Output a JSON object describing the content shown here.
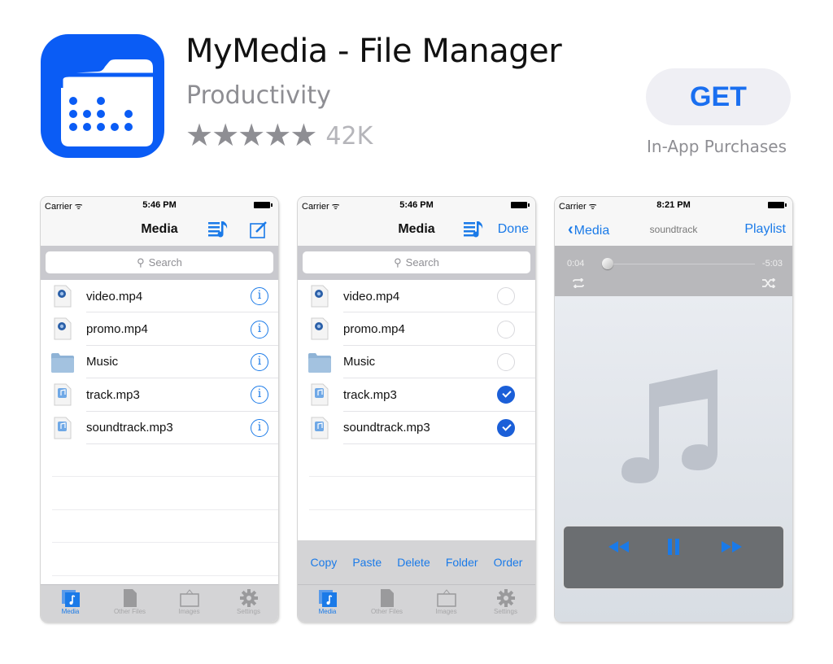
{
  "app": {
    "name": "MyMedia - File Manager",
    "category": "Productivity",
    "rating_stars": 4.5,
    "rating_max": 5,
    "rating_count": "42K",
    "get_label": "GET",
    "in_app_purchases": "In-App Purchases",
    "icon": "folder-dots-icon",
    "brand_color": "#0a5cf5",
    "accent_color": "#1a7ae8"
  },
  "screens": [
    {
      "status": {
        "carrier": "Carrier",
        "time": "5:46 PM"
      },
      "nav": {
        "title": "Media",
        "right_icons": [
          "playlist-icon",
          "compose-icon"
        ]
      },
      "search_placeholder": "Search",
      "files": [
        {
          "name": "video.mp4",
          "type": "video"
        },
        {
          "name": "promo.mp4",
          "type": "video"
        },
        {
          "name": "Music",
          "type": "folder"
        },
        {
          "name": "track.mp3",
          "type": "audio"
        },
        {
          "name": "soundtrack.mp3",
          "type": "audio"
        }
      ],
      "tabs": [
        {
          "label": "Media",
          "icon": "media-icon",
          "active": true
        },
        {
          "label": "Other Files",
          "icon": "document-icon",
          "active": false
        },
        {
          "label": "Images",
          "icon": "picture-frame-icon",
          "active": false
        },
        {
          "label": "Settings",
          "icon": "gear-icon",
          "active": false
        }
      ]
    },
    {
      "status": {
        "carrier": "Carrier",
        "time": "5:46 PM"
      },
      "nav": {
        "title": "Media",
        "done_label": "Done"
      },
      "search_placeholder": "Search",
      "files": [
        {
          "name": "video.mp4",
          "type": "video",
          "selected": false
        },
        {
          "name": "promo.mp4",
          "type": "video",
          "selected": false
        },
        {
          "name": "Music",
          "type": "folder",
          "selected": false
        },
        {
          "name": "track.mp3",
          "type": "audio",
          "selected": true
        },
        {
          "name": "soundtrack.mp3",
          "type": "audio",
          "selected": true
        }
      ],
      "edit_actions": [
        "Copy",
        "Paste",
        "Delete",
        "Folder",
        "Order"
      ],
      "tabs": [
        {
          "label": "Media",
          "icon": "media-icon",
          "active": true
        },
        {
          "label": "Other Files",
          "icon": "document-icon",
          "active": false
        },
        {
          "label": "Images",
          "icon": "picture-frame-icon",
          "active": false
        },
        {
          "label": "Settings",
          "icon": "gear-icon",
          "active": false
        }
      ]
    },
    {
      "status": {
        "carrier": "Carrier",
        "time": "8:21 PM"
      },
      "nav": {
        "back_label": "Media",
        "title": "soundtrack",
        "right_label": "Playlist"
      },
      "player": {
        "elapsed": "0:04",
        "remaining": "-5:03",
        "progress": 0.013,
        "state": "playing"
      }
    }
  ]
}
